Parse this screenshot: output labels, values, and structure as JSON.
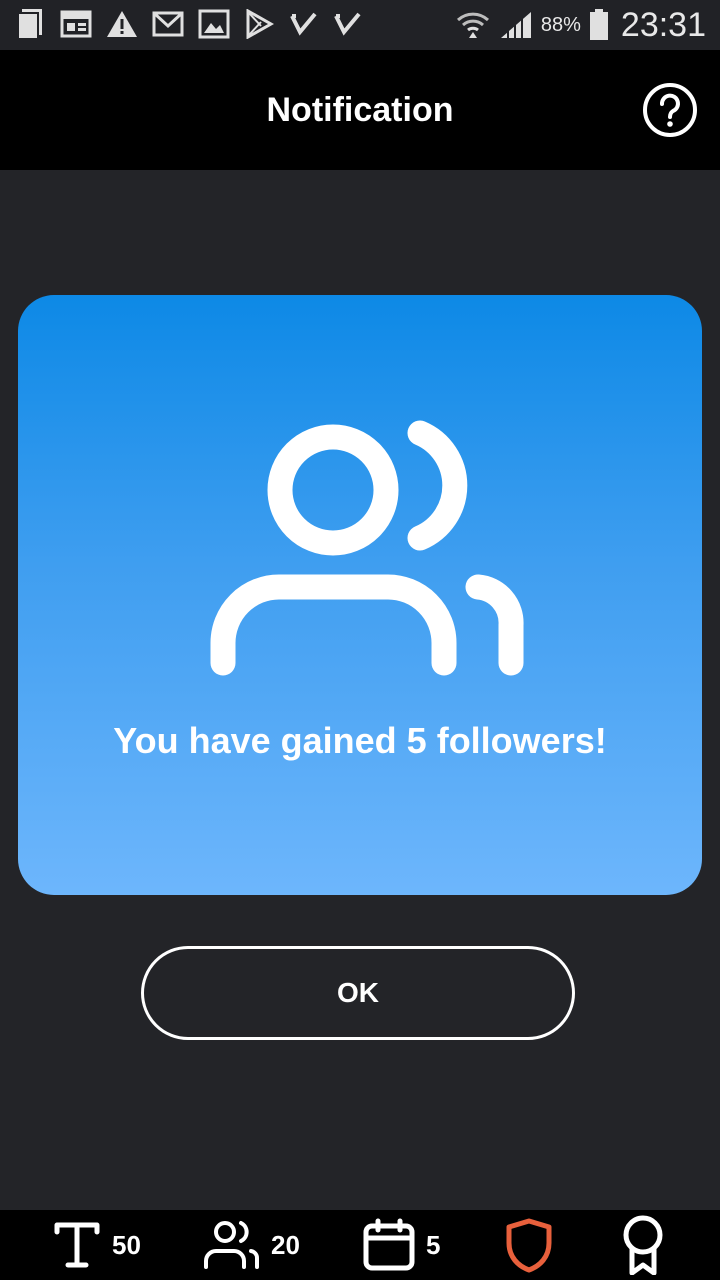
{
  "status_bar": {
    "battery": "88%",
    "time": "23:31"
  },
  "header": {
    "title": "Notification",
    "help_icon": "help-circle-icon"
  },
  "notification": {
    "icon": "users-icon",
    "message": "You have gained 5 followers!"
  },
  "actions": {
    "ok_label": "OK"
  },
  "bottom_bar": {
    "text_count": "50",
    "followers_count": "20",
    "days_count": "5",
    "shield_color": "#e8603c",
    "accent_blue_top": "#0d89e6",
    "accent_blue_bottom": "#6db6fc"
  }
}
